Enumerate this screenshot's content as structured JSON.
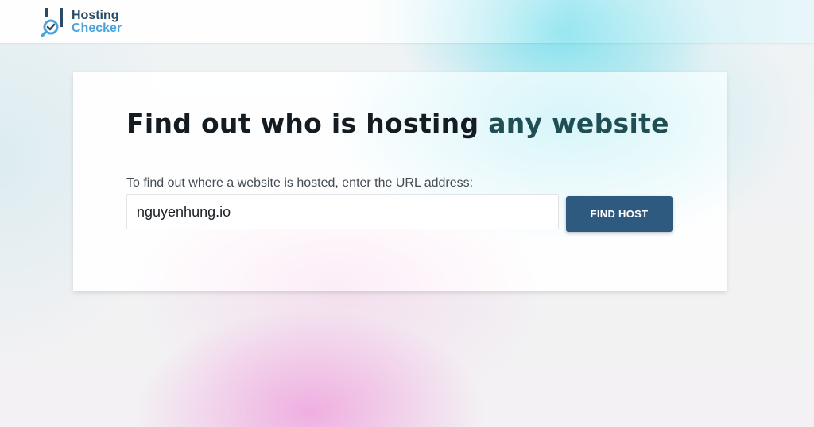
{
  "header": {
    "logo": {
      "line1": "Hosting",
      "line2": "Checker",
      "icon": "magnifier-check-icon"
    }
  },
  "hero": {
    "title_main": "Find out who is hosting",
    "title_accent": "any website",
    "prompt": "To find out where a website is hosted, enter the URL address:",
    "input_value": "nguyenhung.io",
    "button_label": "FIND HOST"
  },
  "colors": {
    "brand_dark": "#2b4a66",
    "brand_light": "#4aa3dc",
    "accent_text": "#1f4e55",
    "button": "#2e5a80"
  }
}
